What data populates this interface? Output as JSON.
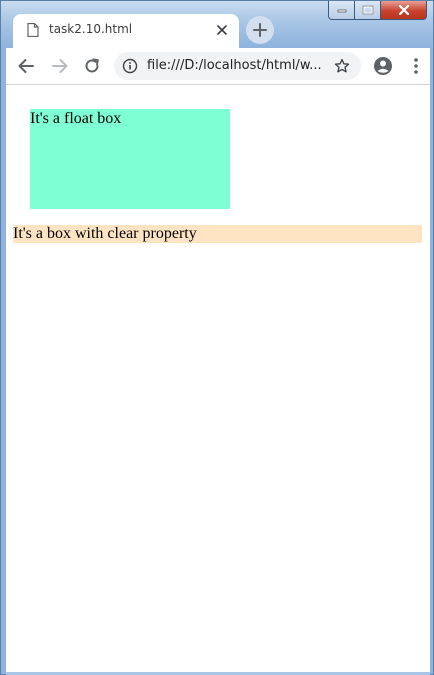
{
  "browser": {
    "tab": {
      "title": "task2.10.html",
      "favicon": "file-icon",
      "close": "close-icon"
    },
    "new_tab_icon": "plus-icon",
    "toolbar": {
      "back_icon": "arrow-left-icon",
      "forward_icon": "arrow-right-icon",
      "reload_icon": "reload-icon",
      "site_info_icon": "info-icon",
      "url": "file:///D:/localhost/html/w...",
      "bookmark_icon": "star-icon",
      "profile_icon": "account-circle-icon",
      "menu_icon": "more-vert-icon"
    },
    "window_controls": {
      "minimize_icon": "minimize-icon",
      "maximize_icon": "maximize-icon",
      "close_icon": "close-icon"
    }
  },
  "page": {
    "float_box_text": "It's a float box",
    "clear_box_text": "It's a box with clear property",
    "colors": {
      "float_box_bg": "#7fffd4",
      "clear_box_bg": "#ffe4c4"
    }
  }
}
